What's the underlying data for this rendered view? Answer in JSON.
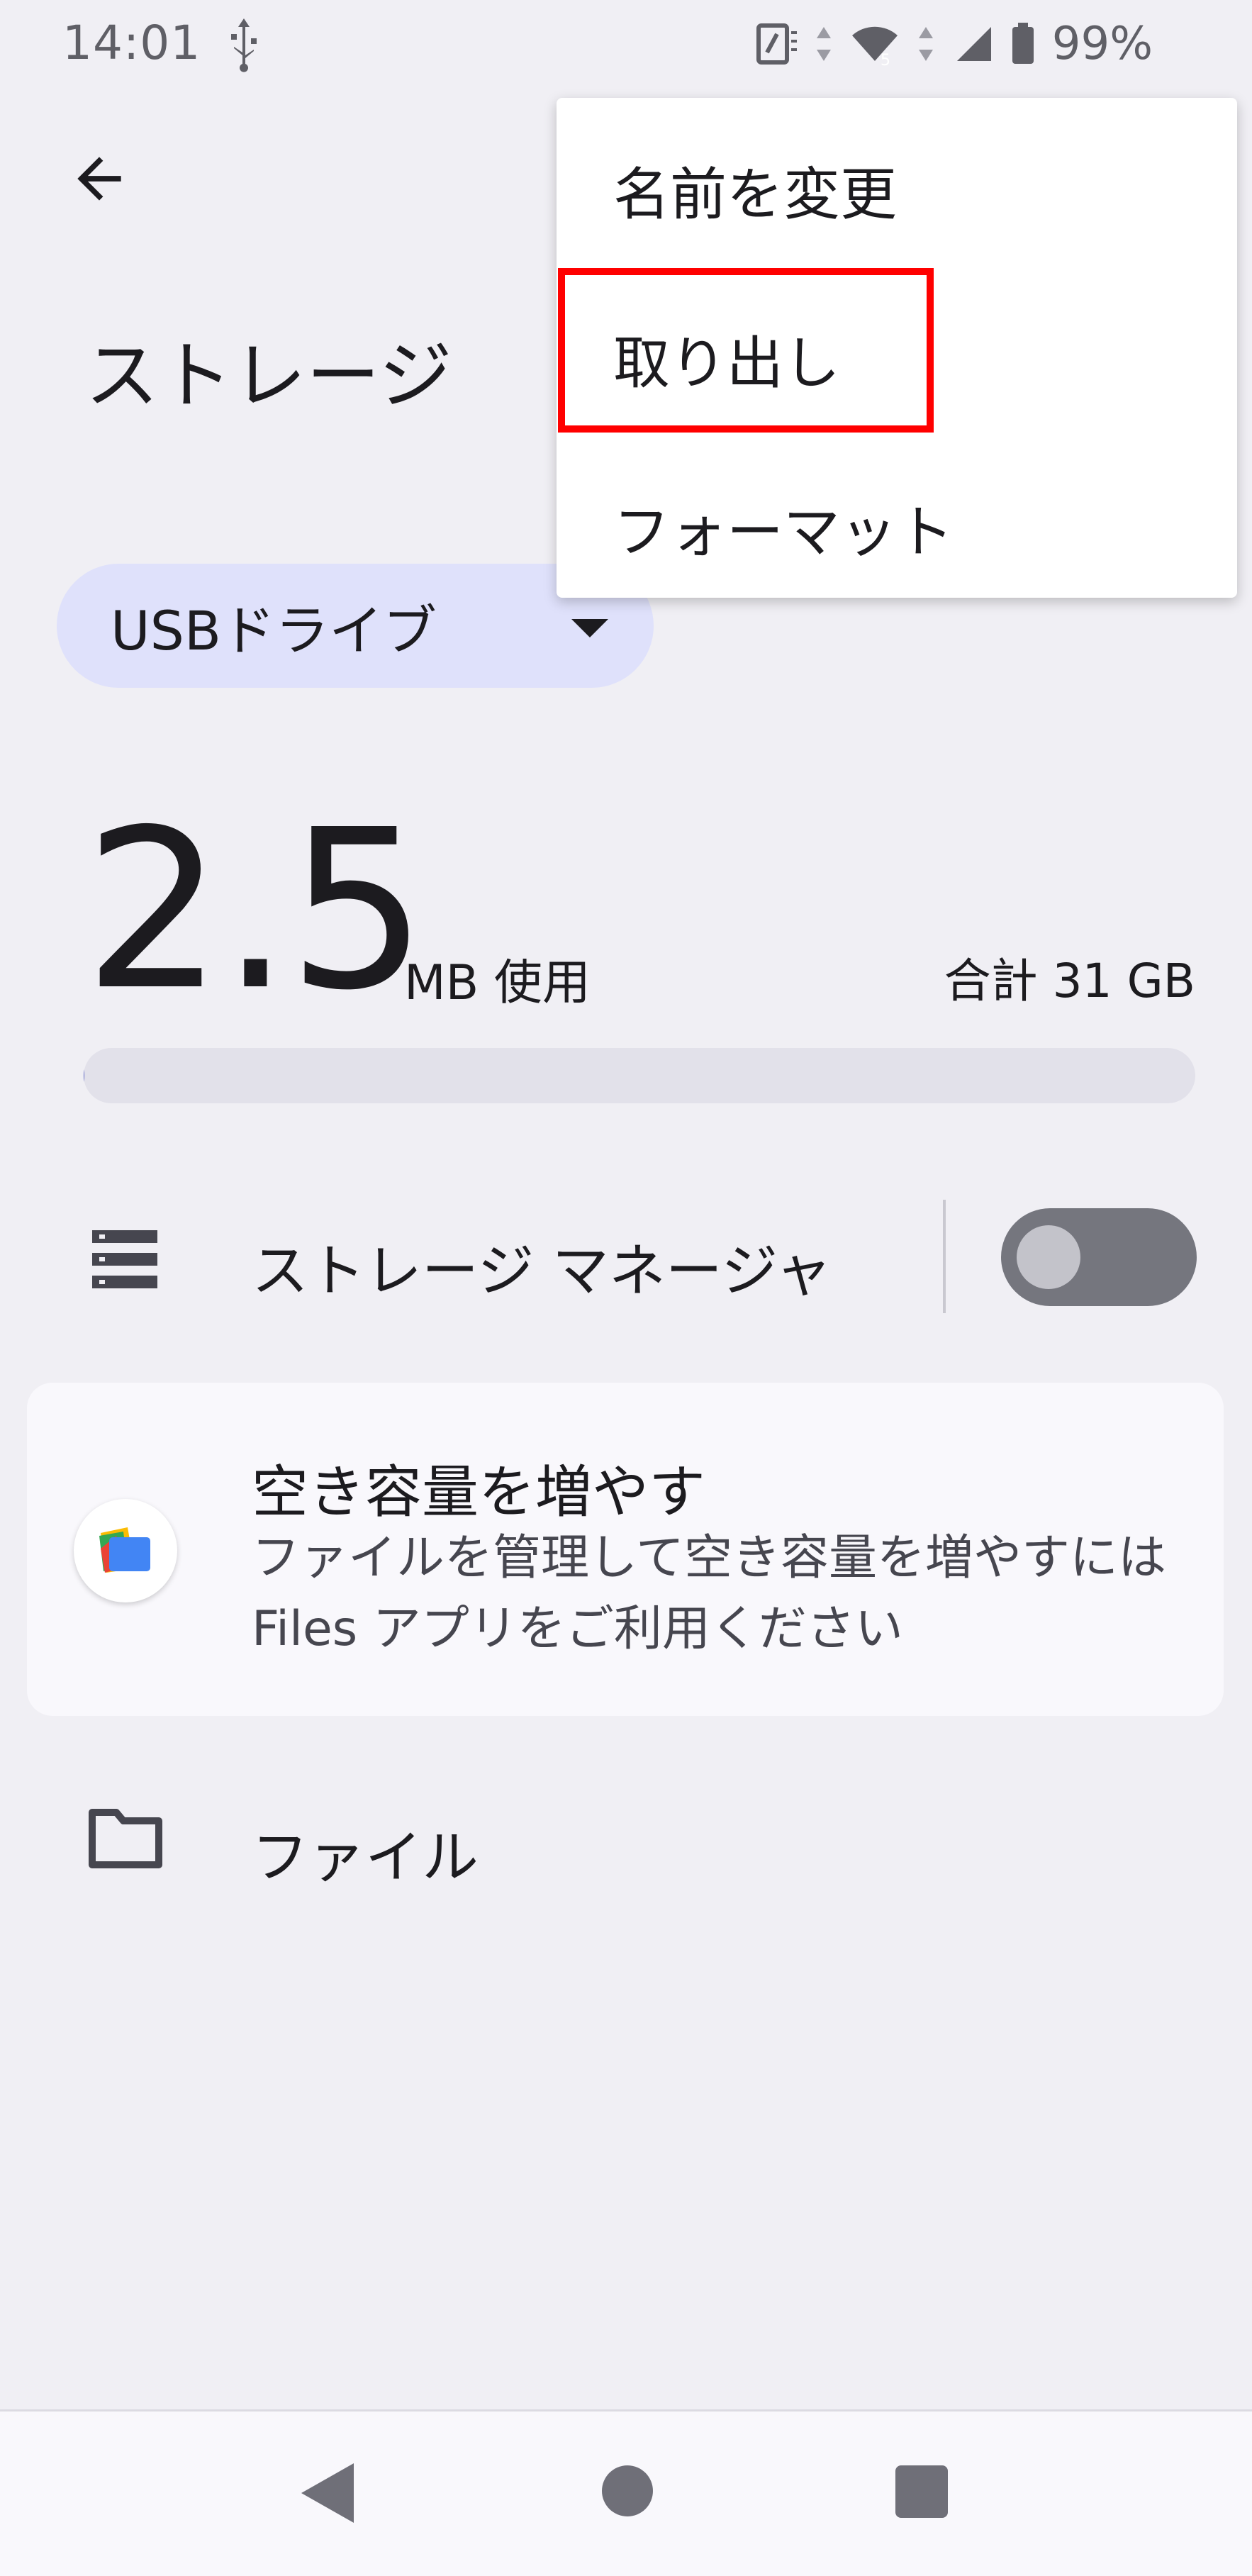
{
  "status_bar": {
    "time": "14:01",
    "battery_percent": "99%",
    "icons": [
      "usb-icon",
      "nfc-icon",
      "data-activity-icon",
      "wifi-icon",
      "signal-icon",
      "battery-icon"
    ]
  },
  "toolbar": {
    "back_icon": "arrow-left-icon",
    "title": "ストレージ"
  },
  "volume_selector": {
    "selected": "USBドライブ",
    "icon": "dropdown-arrow-icon"
  },
  "usage": {
    "used_value": "2.5",
    "used_unit": "MB 使用",
    "total": "合計 31 GB",
    "fraction_used": 0.0001
  },
  "storage_manager": {
    "label": "ストレージ マネージャ",
    "enabled": false,
    "icon": "list-icon"
  },
  "free_up_card": {
    "title": "空き容量を増やす",
    "description": "ファイルを管理して空き容量を増やすには Files アプリをご利用ください",
    "icon": "files-app-icon"
  },
  "files_row": {
    "label": "ファイル",
    "icon": "folder-icon"
  },
  "overflow_menu": {
    "items": [
      "名前を変更",
      "取り出し",
      "フォーマット"
    ],
    "highlighted": "取り出し",
    "highlight_color": "#ff0000"
  },
  "nav_bar": {
    "icons": [
      "nav-back-icon",
      "nav-home-icon",
      "nav-recents-icon"
    ]
  },
  "colors": {
    "background": "#f0eff4",
    "chip": "#dfe1fb",
    "toggle_off": "#75767e"
  }
}
